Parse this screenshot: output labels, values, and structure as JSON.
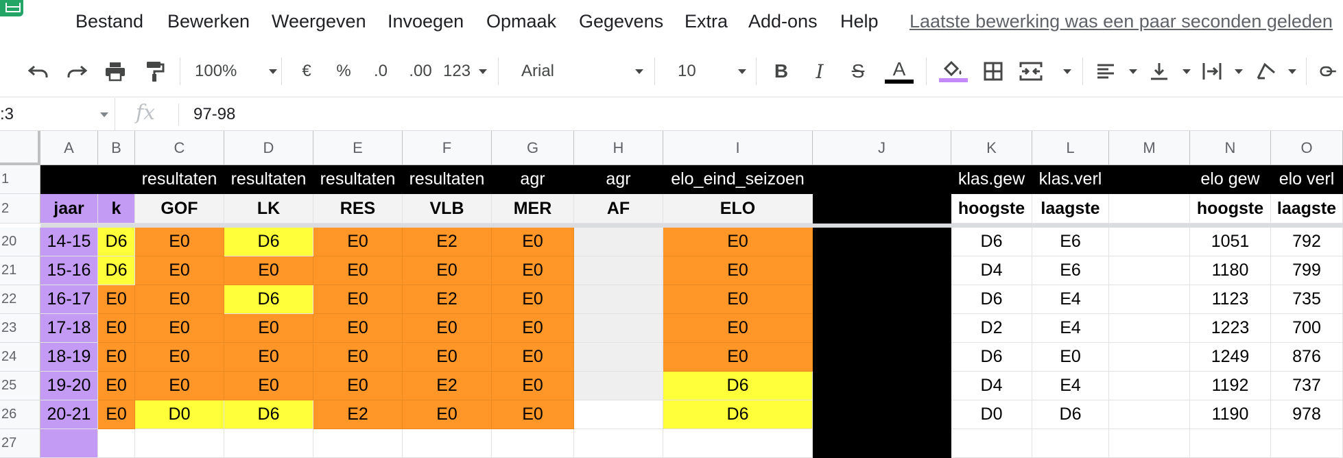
{
  "menu": {
    "items": [
      "Bestand",
      "Bewerken",
      "Weergeven",
      "Invoegen",
      "Opmaak",
      "Gegevens",
      "Extra",
      "Add-ons",
      "Help"
    ],
    "last_edit": "Laatste bewerking was een paar seconden geleden"
  },
  "toolbar": {
    "zoom": "100%",
    "currency": "€",
    "percent": "%",
    "decrease_decimals": ".0",
    "increase_decimals": ".00",
    "more_formats": "123",
    "font": "Arial",
    "font_size": "10",
    "bold": "B",
    "italic": "I",
    "strikethrough": "S",
    "text_color_glyph": "A",
    "text_color": "#000000",
    "fill_color": "#c58af9",
    "icons": [
      "undo-icon",
      "redo-icon",
      "print-icon",
      "paint-format-icon",
      "fill-color-icon",
      "borders-icon",
      "merge-cells-icon",
      "align-horizontal-icon",
      "align-vertical-icon",
      "text-wrap-icon",
      "text-rotate-icon",
      "link-icon"
    ]
  },
  "formula_bar": {
    "name_box": ":3",
    "fx": "fx",
    "value": "97-98"
  },
  "columns": [
    "A",
    "B",
    "C",
    "D",
    "E",
    "F",
    "G",
    "H",
    "I",
    "J",
    "K",
    "L",
    "M",
    "N",
    "O"
  ],
  "colors": {
    "purple": "#c39bf4",
    "yellow": "#ffff3a",
    "orange": "#ff9627",
    "black": "#000000",
    "gray": "#efefef",
    "white": "#ffffff",
    "header_light": "#f3f3f3"
  },
  "header_rows": [
    {
      "row": "1",
      "cells": [
        "",
        "",
        "resultaten",
        "resultaten",
        "resultaten",
        "resultaten",
        "agr",
        "agr",
        "elo_eind_seizoen",
        "",
        "klas.gew",
        "klas.verl",
        "",
        "elo gew",
        "elo verl"
      ]
    },
    {
      "row": "2",
      "cells": [
        "jaar",
        "k",
        "GOF",
        "LK",
        "RES",
        "VLB",
        "MER",
        "AF",
        "ELO",
        "",
        "hoogste",
        "laagste",
        "",
        "hoogste",
        "laagste"
      ]
    }
  ],
  "data_rows": [
    {
      "row": "20",
      "cells": [
        "14-15",
        "D6",
        "E0",
        "D6",
        "E0",
        "E2",
        "E0",
        "",
        "E0",
        "",
        "D6",
        "E6",
        "",
        "1051",
        "792"
      ]
    },
    {
      "row": "21",
      "cells": [
        "15-16",
        "D6",
        "E0",
        "E0",
        "E0",
        "E0",
        "E0",
        "",
        "E0",
        "",
        "D4",
        "E6",
        "",
        "1180",
        "799"
      ]
    },
    {
      "row": "22",
      "cells": [
        "16-17",
        "E0",
        "E0",
        "D6",
        "E0",
        "E2",
        "E0",
        "",
        "E0",
        "",
        "D6",
        "E4",
        "",
        "1123",
        "735"
      ]
    },
    {
      "row": "23",
      "cells": [
        "17-18",
        "E0",
        "E0",
        "E0",
        "E0",
        "E0",
        "E0",
        "",
        "E0",
        "",
        "D2",
        "E4",
        "",
        "1223",
        "700"
      ]
    },
    {
      "row": "24",
      "cells": [
        "18-19",
        "E0",
        "E0",
        "E0",
        "E0",
        "E0",
        "E0",
        "",
        "E0",
        "",
        "D6",
        "E0",
        "",
        "1249",
        "876"
      ]
    },
    {
      "row": "25",
      "cells": [
        "19-20",
        "E0",
        "E0",
        "E0",
        "E0",
        "E2",
        "E0",
        "",
        "D6",
        "",
        "D4",
        "E4",
        "",
        "1192",
        "737"
      ]
    },
    {
      "row": "26",
      "cells": [
        "20-21",
        "E0",
        "D0",
        "D6",
        "E2",
        "E0",
        "E0",
        "",
        "D6",
        "",
        "D0",
        "D6",
        "",
        "1190",
        "978"
      ]
    },
    {
      "row": "27",
      "cells": [
        "",
        "",
        "",
        "",
        "",
        "",
        "",
        "",
        "",
        "",
        "",
        "",
        "",
        "",
        ""
      ]
    }
  ]
}
